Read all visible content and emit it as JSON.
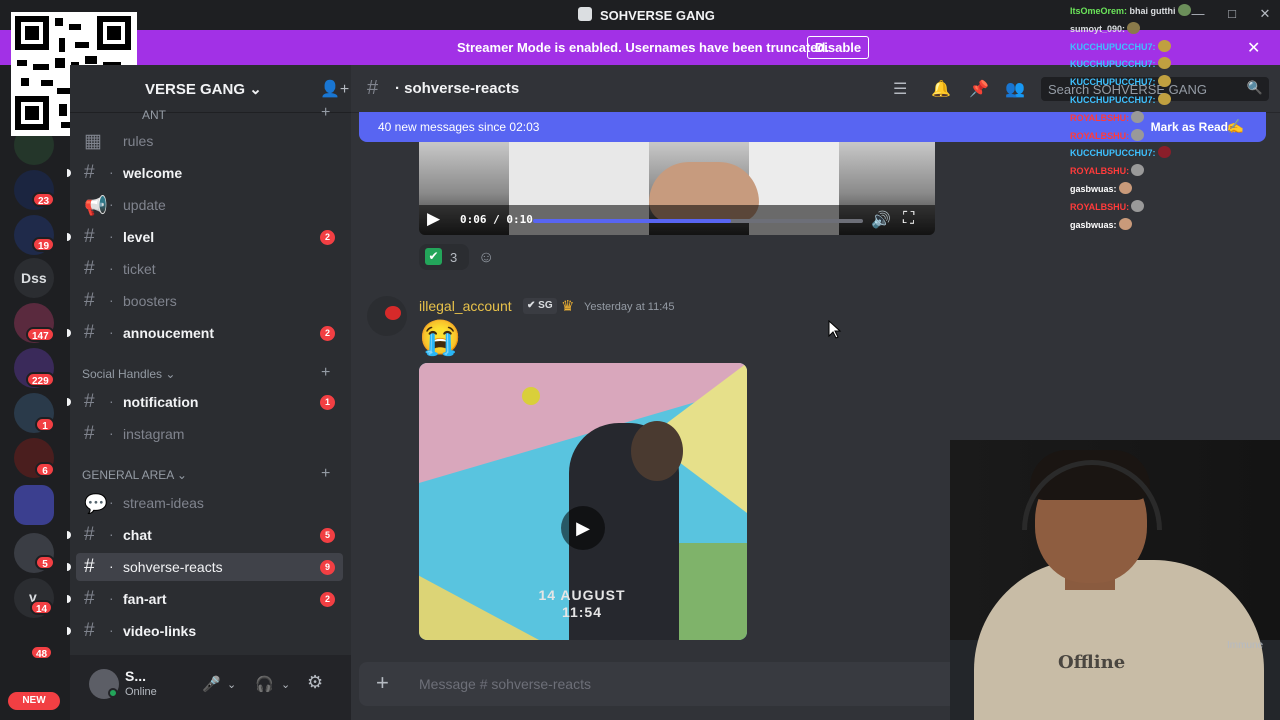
{
  "window": {
    "title": "SOHVERSE GANG"
  },
  "banner": {
    "message": "Streamer Mode is enabled. Usernames have been truncated.",
    "action": "Disable"
  },
  "rail": {
    "badges": [
      "23",
      "19",
      "147",
      "229",
      "1",
      "6",
      "5",
      "14",
      "48"
    ],
    "dss": "Dss",
    "v": "v",
    "new": "NEW"
  },
  "server": {
    "name": "SOHVERSE GANG",
    "name_visible": "VERSE GANG"
  },
  "channels": {
    "partial_category": "ANT",
    "items": [
      {
        "name": "rules",
        "unread": false,
        "badge": ""
      },
      {
        "name": "welcome",
        "unread": true,
        "badge": ""
      },
      {
        "name": "update",
        "unread": false,
        "badge": ""
      },
      {
        "name": "level",
        "unread": true,
        "badge": "2"
      },
      {
        "name": "ticket",
        "unread": false,
        "badge": ""
      },
      {
        "name": "boosters",
        "unread": false,
        "badge": ""
      },
      {
        "name": "annoucement",
        "unread": true,
        "badge": "2"
      }
    ],
    "social_category": "Social Handles",
    "social": [
      {
        "name": "notification",
        "unread": true,
        "badge": "1"
      },
      {
        "name": "instagram",
        "unread": false,
        "badge": ""
      }
    ],
    "general_category": "GENERAL AREA",
    "general": [
      {
        "name": "stream-ideas",
        "unread": false,
        "badge": ""
      },
      {
        "name": "chat",
        "unread": true,
        "badge": "5"
      },
      {
        "name": "sohverse-reacts",
        "unread": false,
        "badge": "9",
        "active": true
      },
      {
        "name": "fan-art",
        "unread": true,
        "badge": "2"
      },
      {
        "name": "video-links",
        "unread": true,
        "badge": ""
      }
    ]
  },
  "user": {
    "name": "S...",
    "status": "Online"
  },
  "header": {
    "channel": "sohverse-reacts",
    "search_placeholder": "Search SOHVERSE GANG"
  },
  "new_messages": {
    "text": "40 new messages since 02:03",
    "action": "Mark as Read"
  },
  "video1": {
    "time": "0:06 / 0:10",
    "progress": 0.6
  },
  "reaction": {
    "count": "3"
  },
  "message": {
    "author": "illegal_account",
    "tag": "SG",
    "timestamp": "Yesterday at 11:45",
    "emoji": "😭"
  },
  "video2": {
    "date_line1": "14 AUGUST",
    "date_line2": "11:54"
  },
  "composer": {
    "placeholder": "Message #  sohverse-reacts"
  },
  "overlay_chat": [
    {
      "user": "ItsOmeOrem",
      "text": "bhai gutthi",
      "color": "#6be45a"
    },
    {
      "user": "sumoyt_090",
      "text": "",
      "color": "#dbdee1"
    },
    {
      "user": "KUCCHUPUCCHU7",
      "text": "",
      "color": "#3ec1ff"
    },
    {
      "user": "KUCCHUPUCCHU7",
      "text": "",
      "color": "#3ec1ff"
    },
    {
      "user": "KUCCHUPUCCHU7",
      "text": "",
      "color": "#3ec1ff"
    },
    {
      "user": "KUCCHUPUCCHU7",
      "text": "",
      "color": "#3ec1ff"
    },
    {
      "user": "ROYALBSHU",
      "text": "",
      "color": "#ff3b3b"
    },
    {
      "user": "ROYALBSHU",
      "text": "",
      "color": "#ff3b3b"
    },
    {
      "user": "KUCCHUPUCCHU7",
      "text": "",
      "color": "#3ec1ff"
    },
    {
      "user": "ROYALBSHU",
      "text": "",
      "color": "#ff3b3b"
    },
    {
      "user": "gasbwuas",
      "text": "",
      "color": "#ffffff"
    },
    {
      "user": "ROYALBSHU",
      "text": "",
      "color": "#ff3b3b"
    },
    {
      "user": "gasbwuas",
      "text": "",
      "color": "#ffffff"
    }
  ],
  "stream": {
    "immune_label": "Immune",
    "shirt_text": "Offline"
  },
  "colors": {
    "accent": "#5865f2",
    "streamer_banner": "#a231e6",
    "danger": "#f23f43",
    "online": "#23a55a"
  }
}
